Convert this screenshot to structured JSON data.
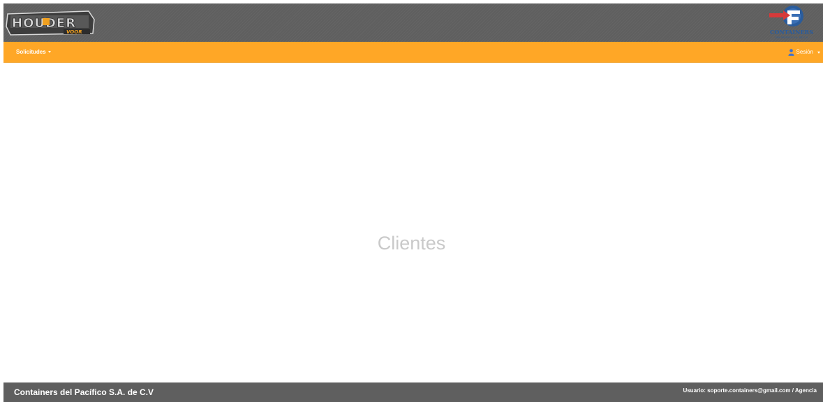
{
  "header": {
    "left_logo_text": "HOUDER",
    "left_logo_subtext": "VOOR",
    "right_logo_text": "CONTAINERS",
    "right_logo_subtext": "DEL PACIFICO S.A. DE C.V"
  },
  "nav": {
    "left_menu_label": "Solicitudes",
    "right_menu_label": "Sesión",
    "icons": [
      "caret-down-icon",
      "user-icon"
    ],
    "bar_color": "#ffa726"
  },
  "main": {
    "title": "Clientes"
  },
  "footer": {
    "company": "Containers del Pacífico S.A. de C.V",
    "user_info": "Usuario: soporte.containers@gmail.com / Agencia"
  },
  "colors": {
    "header_bg": "#5f5f5f",
    "accent_orange": "#ffa726",
    "title_gray": "#c9c9c9",
    "logo_red": "#d63a3a",
    "logo_blue": "#2a5c9c"
  }
}
